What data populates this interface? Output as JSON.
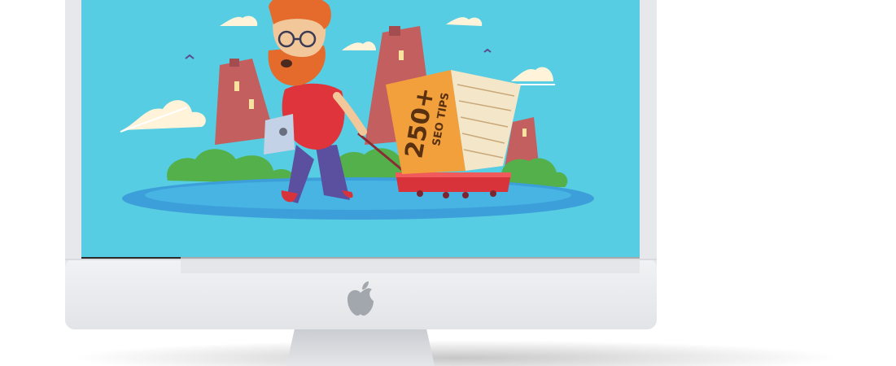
{
  "monitor": {
    "brand_icon": "apple-logo-icon",
    "bezel_color": "#e9eaec",
    "chin_color": "#eceef0"
  },
  "screen": {
    "background_color": "#56cde2",
    "illustration": {
      "character": "bearded-man-with-laptop",
      "box_text_main": "250+",
      "box_text_sub": "SEO TIPS",
      "box_color": "#f2a03c",
      "wagon_color": "#d8323a",
      "shirt_color": "#e0343d",
      "pants_color": "#5b4fa0",
      "hair_color": "#e46b2c",
      "tower_color": "#c35f5e",
      "bush_color": "#53b04a"
    }
  }
}
